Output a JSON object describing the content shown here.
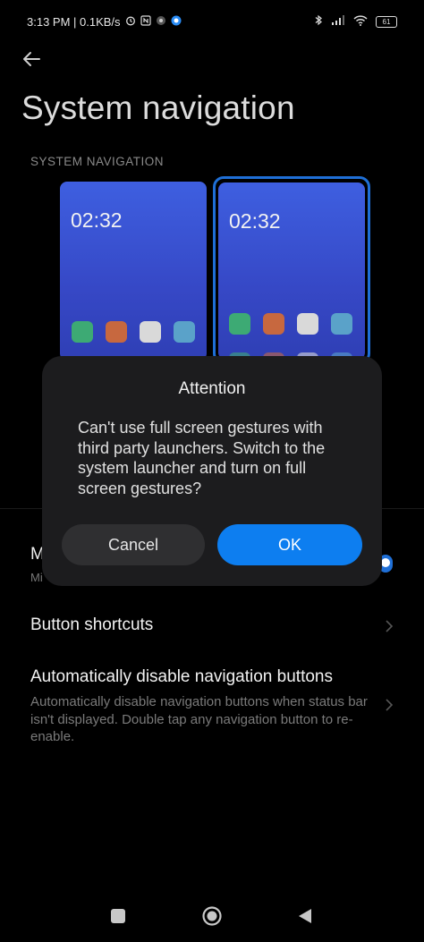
{
  "status_bar": {
    "time_speed": "3:13 PM | 0.1KB/s",
    "battery": "61",
    "icons": [
      "alarm-icon",
      "nfc-icon",
      "bluetooth-icon",
      "signal-icon",
      "wifi-icon",
      "battery-icon"
    ]
  },
  "header": {
    "title": "System navigation"
  },
  "section": {
    "header": "SYSTEM NAVIGATION"
  },
  "previews": [
    {
      "clock": "02:32",
      "selected": false
    },
    {
      "clock": "02:32",
      "selected": true
    }
  ],
  "app_icon_colors": [
    "#3daa74",
    "#c7683f",
    "#d9d9d9",
    "#5aa2c9"
  ],
  "dialog": {
    "title": "Attention",
    "message": "Can't use full screen gestures with third party launchers. Switch to the system launcher and turn on full screen gestures?",
    "cancel_label": "Cancel",
    "ok_label": "OK"
  },
  "partially_hidden_item": {
    "title_visible": "M",
    "subtitle_visible": "Mi"
  },
  "settings": {
    "button_shortcuts": "Button shortcuts",
    "auto_disable_title": "Automatically disable navigation buttons",
    "auto_disable_desc": "Automatically disable navigation buttons when status bar isn't displayed. Double tap any navigation button to re-enable."
  },
  "colors": {
    "accent": "#0d7ef0",
    "dialog_bg": "#1c1c1e",
    "background": "#000000"
  }
}
